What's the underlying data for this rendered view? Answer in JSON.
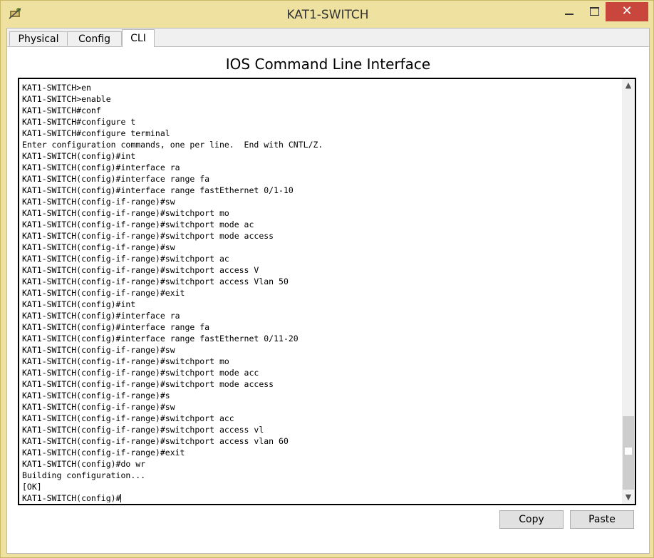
{
  "window": {
    "title": "KAT1-SWITCH",
    "close_glyph": "✕"
  },
  "tabs": [
    {
      "label": "Physical"
    },
    {
      "label": "Config"
    },
    {
      "label": "CLI"
    }
  ],
  "panel_title": "IOS Command Line Interface",
  "console": {
    "lines": [
      "KAT1-SWITCH>en",
      "KAT1-SWITCH>enable",
      "KAT1-SWITCH#conf",
      "KAT1-SWITCH#configure t",
      "KAT1-SWITCH#configure terminal",
      "Enter configuration commands, one per line.  End with CNTL/Z.",
      "KAT1-SWITCH(config)#int",
      "KAT1-SWITCH(config)#interface ra",
      "KAT1-SWITCH(config)#interface range fa",
      "KAT1-SWITCH(config)#interface range fastEthernet 0/1-10",
      "KAT1-SWITCH(config-if-range)#sw",
      "KAT1-SWITCH(config-if-range)#switchport mo",
      "KAT1-SWITCH(config-if-range)#switchport mode ac",
      "KAT1-SWITCH(config-if-range)#switchport mode access",
      "KAT1-SWITCH(config-if-range)#sw",
      "KAT1-SWITCH(config-if-range)#switchport ac",
      "KAT1-SWITCH(config-if-range)#switchport access V",
      "KAT1-SWITCH(config-if-range)#switchport access Vlan 50",
      "KAT1-SWITCH(config-if-range)#exit",
      "KAT1-SWITCH(config)#int",
      "KAT1-SWITCH(config)#interface ra",
      "KAT1-SWITCH(config)#interface range fa",
      "KAT1-SWITCH(config)#interface range fastEthernet 0/11-20",
      "KAT1-SWITCH(config-if-range)#sw",
      "KAT1-SWITCH(config-if-range)#switchport mo",
      "KAT1-SWITCH(config-if-range)#switchport mode acc",
      "KAT1-SWITCH(config-if-range)#switchport mode access",
      "KAT1-SWITCH(config-if-range)#s",
      "KAT1-SWITCH(config-if-range)#sw",
      "KAT1-SWITCH(config-if-range)#switchport acc",
      "KAT1-SWITCH(config-if-range)#switchport access vl",
      "KAT1-SWITCH(config-if-range)#switchport access vlan 60",
      "KAT1-SWITCH(config-if-range)#exit",
      "KAT1-SWITCH(config)#do wr",
      "Building configuration...",
      "[OK]"
    ],
    "prompt": "KAT1-SWITCH(config)#"
  },
  "buttons": {
    "copy": "Copy",
    "paste": "Paste"
  },
  "icons": {
    "app": "packet-tracer-device-icon",
    "scroll_up": "▲",
    "scroll_down": "▼"
  }
}
